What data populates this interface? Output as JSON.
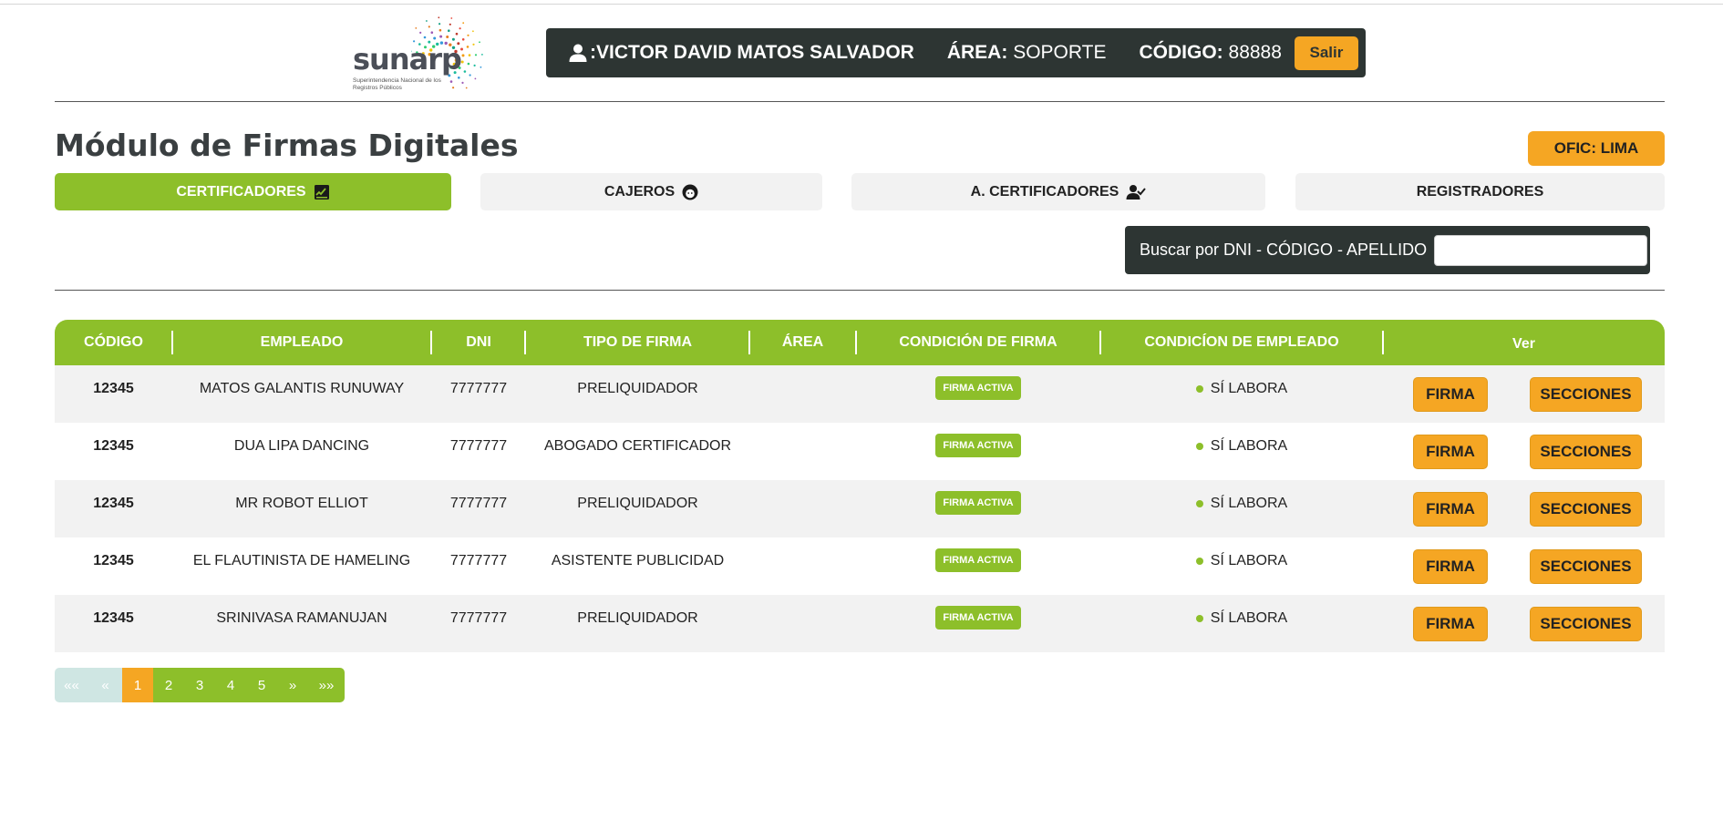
{
  "logo": {
    "brand": "sunarp",
    "tagline": "Superintendencia Nacional de los Registros Públicos",
    "icon": "sunarp-burst-logo"
  },
  "header": {
    "user_icon": "user-icon",
    "user_name": ":VICTOR DAVID MATOS SALVADOR",
    "area_label": "ÁREA:",
    "area_value": "SOPORTE",
    "code_label": "CÓDIGO:",
    "code_value": "88888",
    "logout_label": "Salir"
  },
  "page": {
    "title": "Módulo de Firmas Digitales",
    "office_label": "OFIC: LIMA"
  },
  "tabs": [
    {
      "label": "CERTIFICADORES",
      "icon": "signature-pad-icon",
      "active": true
    },
    {
      "label": "CAJEROS",
      "icon": "face-icon",
      "active": false
    },
    {
      "label": "A. CERTIFICADORES",
      "icon": "user-check-icon",
      "active": false
    },
    {
      "label": "REGISTRADORES",
      "icon": "",
      "active": false
    }
  ],
  "search": {
    "label": "Buscar por DNI - CÓDIGO - APELLIDO",
    "value": "",
    "placeholder": ""
  },
  "table": {
    "columns": [
      "CÓDIGO",
      "EMPLEADO",
      "DNI",
      "TIPO DE FIRMA",
      "ÁREA",
      "CONDICIÓN DE FIRMA",
      "CONDICÍON DE EMPLEADO",
      "Ver"
    ],
    "rows": [
      {
        "codigo": "12345",
        "empleado": "MATOS GALANTIS RUNUWAY",
        "dni": "7777777",
        "tipo": "PRELIQUIDADOR",
        "area": "",
        "condicion_firma": "FIRMA ACTIVA",
        "condicion_empleado": "SÍ LABORA",
        "btn_firma": "FIRMA",
        "btn_secciones": "SECCIONES"
      },
      {
        "codigo": "12345",
        "empleado": "DUA LIPA DANCING",
        "dni": "7777777",
        "tipo": "ABOGADO CERTIFICADOR",
        "area": "",
        "condicion_firma": "FIRMA ACTIVA",
        "condicion_empleado": "SÍ LABORA",
        "btn_firma": "FIRMA",
        "btn_secciones": "SECCIONES"
      },
      {
        "codigo": "12345",
        "empleado": "MR ROBOT ELLIOT",
        "dni": "7777777",
        "tipo": "PRELIQUIDADOR",
        "area": "",
        "condicion_firma": "FIRMA ACTIVA",
        "condicion_empleado": "SÍ LABORA",
        "btn_firma": "FIRMA",
        "btn_secciones": "SECCIONES"
      },
      {
        "codigo": "12345",
        "empleado": "EL FLAUTINISTA DE HAMELING",
        "dni": "7777777",
        "tipo": "ASISTENTE PUBLICIDAD",
        "area": "",
        "condicion_firma": "FIRMA ACTIVA",
        "condicion_empleado": "SÍ LABORA",
        "btn_firma": "FIRMA",
        "btn_secciones": "SECCIONES"
      },
      {
        "codigo": "12345",
        "empleado": "SRINIVASA RAMANUJAN",
        "dni": "7777777",
        "tipo": "PRELIQUIDADOR",
        "area": "",
        "condicion_firma": "FIRMA ACTIVA",
        "condicion_empleado": "SÍ LABORA",
        "btn_firma": "FIRMA",
        "btn_secciones": "SECCIONES"
      }
    ]
  },
  "pagination": {
    "first": "««",
    "prev": "«",
    "pages": [
      "1",
      "2",
      "3",
      "4",
      "5"
    ],
    "current": "1",
    "next": "»",
    "last": "»»"
  },
  "colors": {
    "accent_green": "#8dbf2a",
    "accent_orange": "#f5a623",
    "dark_bar": "#2d3533"
  }
}
